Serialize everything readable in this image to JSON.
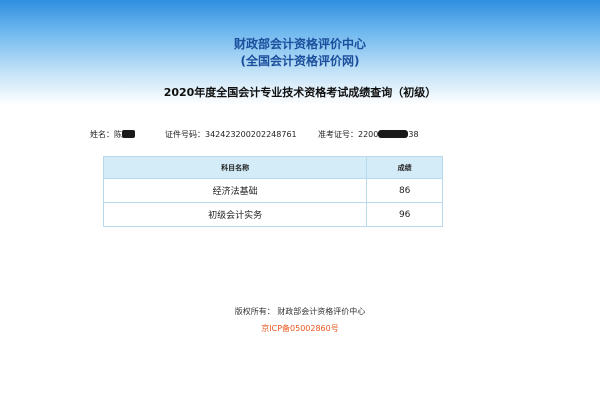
{
  "header": {
    "org_name": "财政部会计资格评价中心",
    "site_name": "(全国会计资格评价网)"
  },
  "query_title": "2020年度全国会计专业技术资格考试成绩查询（初级）",
  "candidate": {
    "name_label": "姓名：",
    "name_value": "陈",
    "id_label": "证件号码：",
    "id_value": "342423200202248761",
    "ticket_label": "准考证号：",
    "ticket_prefix": "2200",
    "ticket_suffix": "38"
  },
  "score_table": {
    "headers": [
      "科目名称",
      "成绩"
    ],
    "rows": [
      {
        "subject": "经济法基础",
        "score": "86"
      },
      {
        "subject": "初级会计实务",
        "score": "96"
      }
    ]
  },
  "footer": {
    "copyright": "版权所有：  财政部会计资格评价中心",
    "icp": "京ICP备05002860号"
  },
  "colors": {
    "header_text": "#1b4f9c",
    "table_header_bg": "#d4ecf8",
    "icp_text": "#e8561c"
  }
}
